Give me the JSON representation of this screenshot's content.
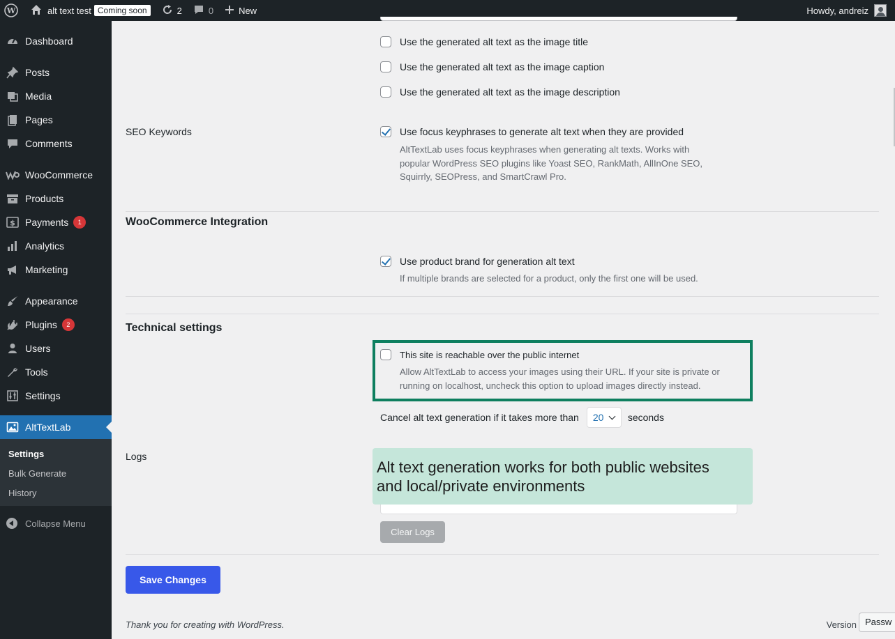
{
  "adminbar": {
    "site_name": "alt text test",
    "coming_soon": "Coming soon",
    "updates_count": "2",
    "comments_count": "0",
    "new_label": "New",
    "howdy": "Howdy, andreiz"
  },
  "sidebar": {
    "items": [
      {
        "label": "Dashboard",
        "icon": "dashboard-icon"
      },
      {
        "label": "Posts",
        "icon": "pin-icon"
      },
      {
        "label": "Media",
        "icon": "media-icon"
      },
      {
        "label": "Pages",
        "icon": "pages-icon"
      },
      {
        "label": "Comments",
        "icon": "comment-icon"
      },
      {
        "label": "WooCommerce",
        "icon": "woo-icon"
      },
      {
        "label": "Products",
        "icon": "archive-icon"
      },
      {
        "label": "Payments",
        "icon": "dollar-icon",
        "badge": "1"
      },
      {
        "label": "Analytics",
        "icon": "bar-chart-icon"
      },
      {
        "label": "Marketing",
        "icon": "megaphone-icon"
      },
      {
        "label": "Appearance",
        "icon": "brush-icon"
      },
      {
        "label": "Plugins",
        "icon": "plug-icon",
        "badge": "2"
      },
      {
        "label": "Users",
        "icon": "user-icon"
      },
      {
        "label": "Tools",
        "icon": "wrench-icon"
      },
      {
        "label": "Settings",
        "icon": "sliders-icon"
      },
      {
        "label": "AltTextLab",
        "icon": "image-icon"
      }
    ],
    "submenu": [
      "Settings",
      "Bulk Generate",
      "History"
    ],
    "collapse": "Collapse Menu"
  },
  "settings": {
    "opt_title": "Use the generated alt text as the image title",
    "opt_caption": "Use the generated alt text as the image caption",
    "opt_description": "Use the generated alt text as the image description",
    "seo_label": "SEO Keywords",
    "seo_option": "Use focus keyphrases to generate alt text when they are provided",
    "seo_desc_1": "AltTextLab uses focus keyphrases when generating alt texts. Works with",
    "seo_desc_2": "popular WordPress SEO plugins like Yoast SEO, RankMath, AllInOne SEO,",
    "seo_desc_3": "Squirrly, SEOPress, and SmartCrawl Pro.",
    "woo_title": "WooCommerce Integration",
    "woo_option": "Use product brand for generation alt text",
    "woo_desc": "If multiple brands are selected for a product, only the first one will be used.",
    "tech_title": "Technical settings",
    "public_option": "This site is reachable over the public internet",
    "public_desc_1": "Allow AltTextLab to access your images using their URL. If your site is private or",
    "public_desc_2": "running on localhost, uncheck this option to upload images directly instead.",
    "timeout_before": "Cancel alt text generation if it takes more than",
    "timeout_value": "20",
    "timeout_after": "seconds",
    "logs_label": "Logs",
    "callout_1": "Alt text generation works for both public websites",
    "callout_2": "and local/private environments",
    "clear_logs": "Clear Logs",
    "save_changes": "Save Changes"
  },
  "footer": {
    "thanks": "Thank you for creating with WordPress.",
    "version": "Version",
    "password_tab": "Passw"
  },
  "colors": {
    "accent": "#2271b1",
    "save_button": "#3858e9",
    "highlight_border": "#0e7f5f",
    "callout_bg": "#c5e6da"
  }
}
